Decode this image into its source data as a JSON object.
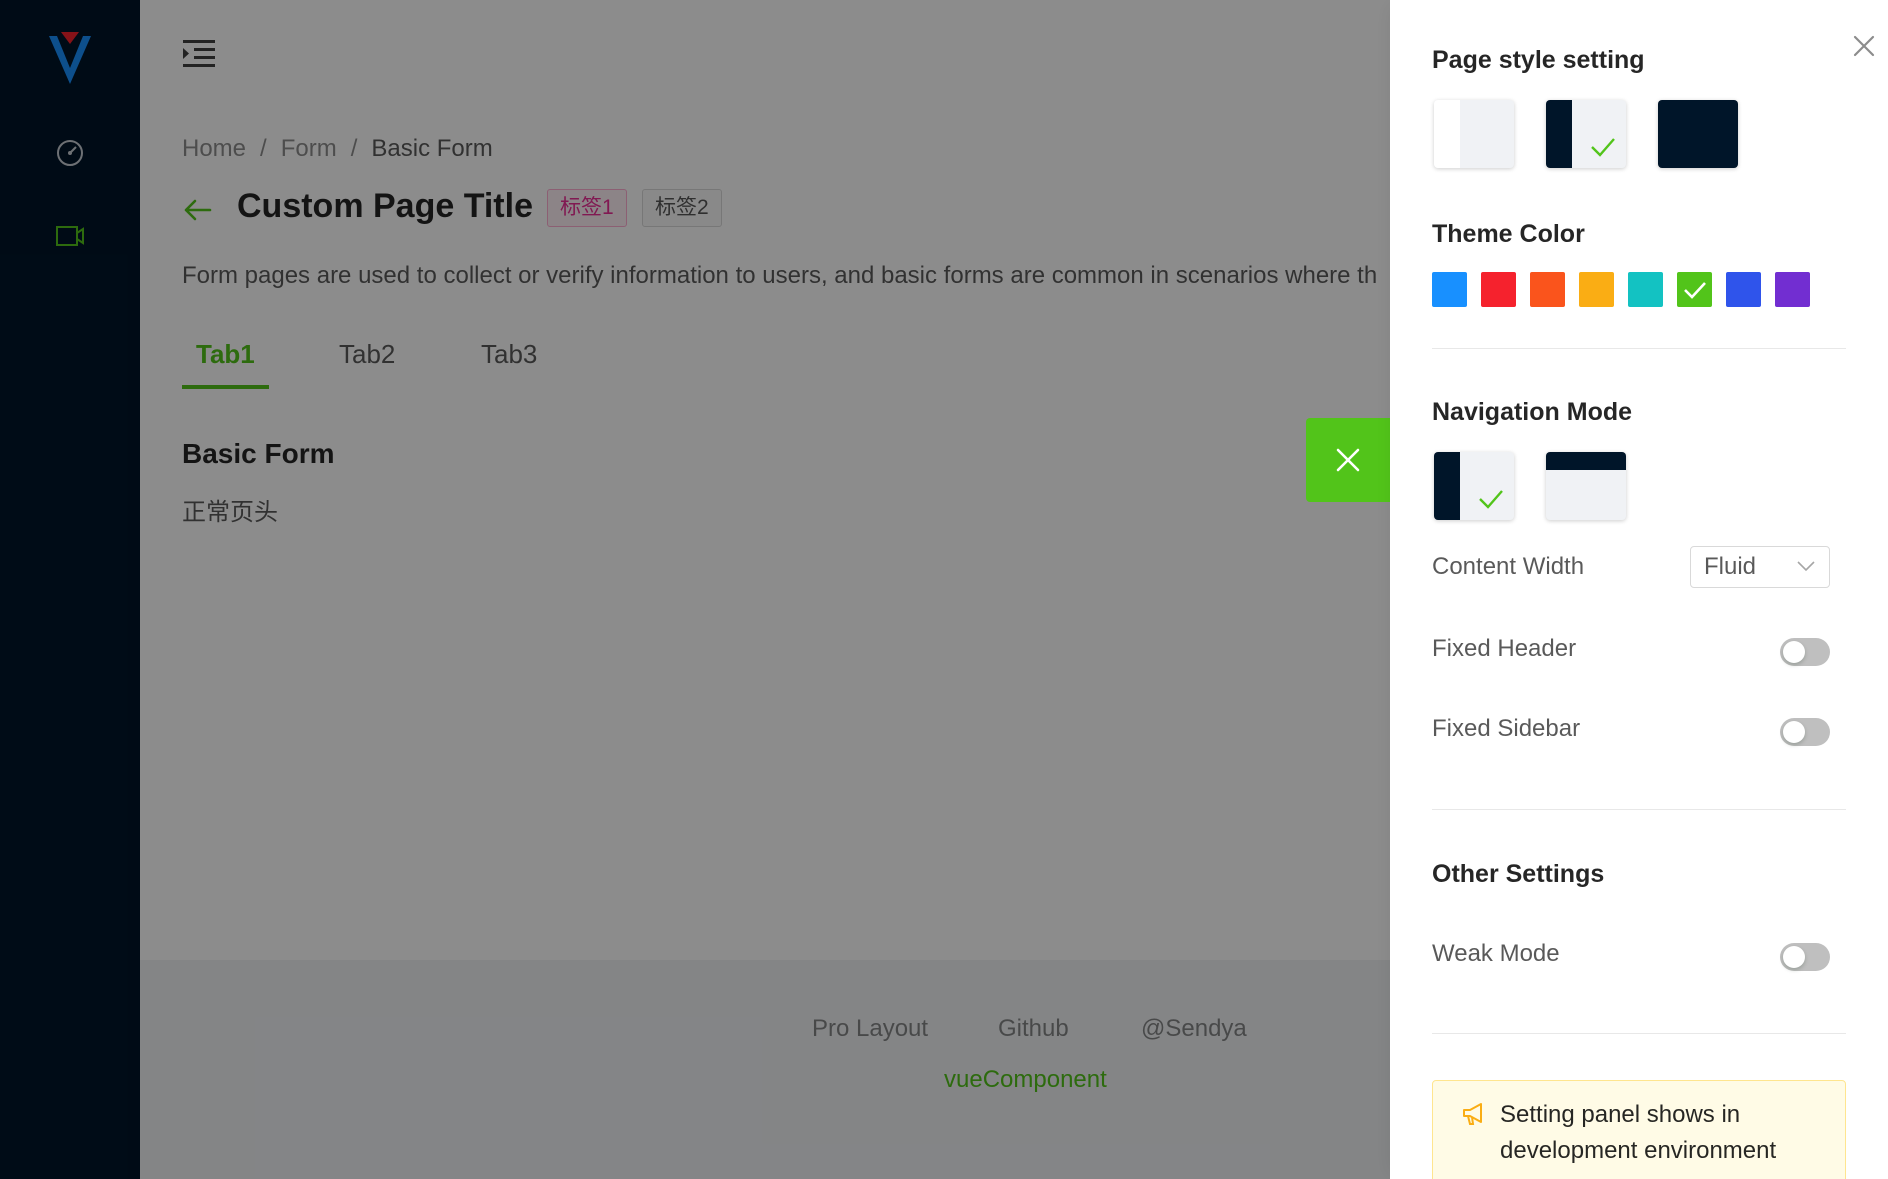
{
  "header": {
    "menu_icon": "menu-fold-icon"
  },
  "sidebar": {
    "logo": "logo-icon",
    "items": [
      {
        "icon": "dashboard-icon",
        "active": false
      },
      {
        "icon": "form-icon",
        "active": true
      }
    ]
  },
  "breadcrumb": {
    "items": [
      "Home",
      "Form",
      "Basic Form"
    ],
    "separator": "/"
  },
  "page": {
    "back_icon": "arrow-left-icon",
    "title": "Custom Page Title",
    "tags": [
      "标签1",
      "标签2"
    ],
    "description": "Form pages are used to collect or verify information to users, and basic forms are common in scenarios where th",
    "tabs": [
      "Tab1",
      "Tab2",
      "Tab3"
    ],
    "active_tab": "Tab1"
  },
  "card": {
    "title": "Basic Form",
    "subtitle": "正常页头"
  },
  "footer": {
    "links": [
      "Pro Layout",
      "Github",
      "@Sendya"
    ],
    "copyright": "vueComponent"
  },
  "drawer": {
    "close_icon": "close-icon",
    "handle_icon": "close-icon",
    "page_style": {
      "title": "Page style setting",
      "options": [
        "light",
        "dark-sider",
        "dark"
      ],
      "selected": "dark-sider"
    },
    "theme_color": {
      "title": "Theme Color",
      "colors": [
        "#1890ff",
        "#f5222d",
        "#fa541c",
        "#faad14",
        "#13c2c2",
        "#52c41a",
        "#2f54eb",
        "#722ed1"
      ],
      "selected": "#52c41a"
    },
    "navigation": {
      "title": "Navigation Mode",
      "options": [
        "side-menu",
        "top-menu"
      ],
      "selected": "side-menu",
      "content_width_label": "Content Width",
      "content_width_value": "Fluid",
      "fixed_header_label": "Fixed Header",
      "fixed_header": false,
      "fixed_sidebar_label": "Fixed Sidebar",
      "fixed_sidebar": false
    },
    "other": {
      "title": "Other Settings",
      "weak_mode_label": "Weak Mode",
      "weak_mode": false
    },
    "alert": {
      "icon": "notification-icon",
      "text": "Setting panel shows in development environment"
    }
  },
  "colors": {
    "primary": "#52c41a",
    "sider": "#001529",
    "tag_magenta": "#eb2f96"
  }
}
